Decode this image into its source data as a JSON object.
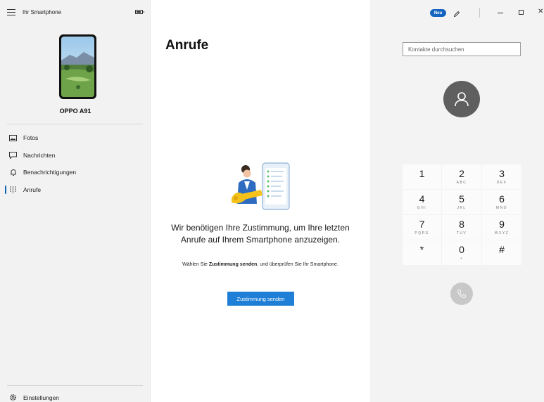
{
  "sidebar": {
    "app_title": "Ihr Smartphone",
    "device_name": "OPPO A91",
    "items": [
      {
        "label": "Fotos",
        "icon": "photos-icon",
        "active": false
      },
      {
        "label": "Nachrichten",
        "icon": "messages-icon",
        "active": false
      },
      {
        "label": "Benachrichtigungen",
        "icon": "bell-icon",
        "active": false
      },
      {
        "label": "Anrufe",
        "icon": "dialpad-icon",
        "active": true
      }
    ],
    "settings_label": "Einstellungen"
  },
  "main": {
    "title": "Anrufe",
    "consent_title": "Wir benötigen Ihre Zustimmung, um Ihre letzten Anrufe auf Ihrem Smartphone anzuzeigen.",
    "consent_desc_prefix": "Wählen Sie ",
    "consent_desc_bold": "Zustimmung senden",
    "consent_desc_suffix": ", und überprüfen Sie Ihr Smartphone.",
    "consent_button": "Zustimmung senden"
  },
  "right": {
    "new_badge": "Neu",
    "search_placeholder": "Kontakte durchsuchen",
    "dialpad": [
      {
        "num": "1",
        "sub": ""
      },
      {
        "num": "2",
        "sub": "ABC"
      },
      {
        "num": "3",
        "sub": "DEF"
      },
      {
        "num": "4",
        "sub": "GHI"
      },
      {
        "num": "5",
        "sub": "JKL"
      },
      {
        "num": "6",
        "sub": "MNO"
      },
      {
        "num": "7",
        "sub": "PQRS"
      },
      {
        "num": "8",
        "sub": "TUV"
      },
      {
        "num": "9",
        "sub": "WXYZ"
      },
      {
        "num": "*",
        "sub": ""
      },
      {
        "num": "0",
        "sub": "+"
      },
      {
        "num": "#",
        "sub": ""
      }
    ]
  },
  "colors": {
    "accent": "#1f7fd6",
    "active_indicator": "#0a64b8",
    "sidebar_bg": "#f2f2f2",
    "right_bg": "#f3f3f3",
    "avatar_bg": "#5f5f5f"
  }
}
